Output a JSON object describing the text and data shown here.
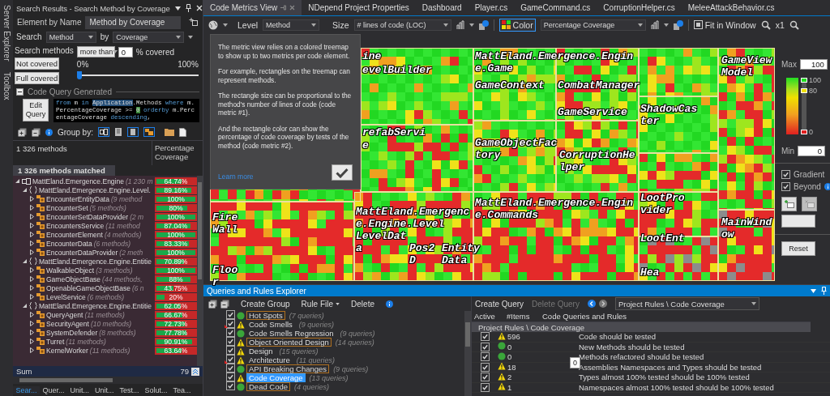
{
  "side_strip": {
    "tabs": [
      "Server Explorer",
      "Toolbox"
    ]
  },
  "search_panel": {
    "title": "Search Results - Search Method by Coverage",
    "tabs": [
      {
        "label": "Element by Name",
        "selected": false
      },
      {
        "label": "Method by Coverage",
        "selected": true
      }
    ],
    "search_label": "Search",
    "search_value": "Method",
    "by_label": "by",
    "by_value": "Coverage",
    "methods_label": "Search methods",
    "buttons": [
      "Not covered",
      "Full covered"
    ],
    "comparison": "more than",
    "threshold": "0",
    "threshold_suffix": "% covered",
    "range_min": "0%",
    "range_max": "100%",
    "slider": {
      "level": 0
    },
    "query_section": {
      "title": "Code Query Generated",
      "expanded": true
    },
    "edit_button": "Edit Query",
    "query_tokens": [
      {
        "text": "from",
        "kind": "keyword"
      },
      {
        "text": " m ",
        "kind": "plain"
      },
      {
        "text": "in ",
        "kind": "keyword"
      },
      {
        "text": "Application",
        "kind": "highlight"
      },
      {
        "text": ".Methods ",
        "kind": "plain"
      },
      {
        "text": "where",
        "kind": "keyword"
      },
      {
        "text": " m.PercentageCoverage >= ",
        "kind": "plain"
      },
      {
        "text": "0",
        "kind": "number"
      },
      {
        "text": " orderby",
        "kind": "keyword"
      },
      {
        "text": " m.PercentageCoverage ",
        "kind": "plain"
      },
      {
        "text": "descending",
        "kind": "keyword"
      },
      {
        "text": ",",
        "kind": "plain"
      }
    ],
    "group_by_label": "Group by:",
    "count_header": "1 326 methods",
    "coverage_header": "Percentage Coverage",
    "matched_label": "1 326 methods matched",
    "tree": [
      {
        "kind": "assembly",
        "name": "MattEland.Emergence.Engine",
        "count": "(1 230 m",
        "level": 0.6474,
        "value": "64.74%",
        "expanded": true,
        "children": [
          {
            "kind": "namespace",
            "name": "MattEland.Emergence.Engine.Level.",
            "level": 0.8916,
            "value": "89.16%",
            "expanded": true,
            "children": [
              {
                "kind": "class",
                "name": "EncounterEntityData",
                "count": "(9 method",
                "level": 1,
                "value": "100%",
                "expanded": false
              },
              {
                "kind": "class",
                "name": "EncounterSet",
                "count": "(5 methods)",
                "level": 0.8,
                "value": "80%",
                "expanded": false
              },
              {
                "kind": "class",
                "name": "EncounterSetDataProvider",
                "count": "(2 m",
                "level": 1,
                "value": "100%",
                "expanded": false
              },
              {
                "kind": "class",
                "name": "EncountersService",
                "count": "(11 method",
                "level": 0.8704,
                "value": "87.04%",
                "expanded": false
              },
              {
                "kind": "class",
                "name": "EncounterElement",
                "count": "(4 methods)",
                "level": 1,
                "value": "100%",
                "expanded": false
              },
              {
                "kind": "class",
                "name": "EncounterData",
                "count": "(6 methods)",
                "level": 0.8333,
                "value": "83.33%",
                "expanded": false
              },
              {
                "kind": "class",
                "name": "EncounterDataProvider",
                "count": "(2 meth",
                "level": 1,
                "value": "100%",
                "expanded": false
              }
            ]
          },
          {
            "kind": "namespace",
            "name": "MattEland.Emergence.Engine.Entitie",
            "level": 0.7089,
            "value": "70.89%",
            "expanded": true,
            "children": [
              {
                "kind": "class",
                "name": "WalkableObject",
                "count": "(3 methods)",
                "level": 1,
                "value": "100%",
                "expanded": false
              },
              {
                "kind": "class",
                "name": "GameObjectBase",
                "count": "(44 methods,",
                "level": 0.88,
                "value": "88%",
                "expanded": false
              },
              {
                "kind": "class",
                "name": "OpenableGameObjectBase",
                "count": "(6 n",
                "level": 0.4375,
                "value": "43.75%",
                "expanded": false
              },
              {
                "kind": "class",
                "name": "LevelService",
                "count": "(6 methods)",
                "level": 0.2,
                "value": "20%",
                "expanded": false
              }
            ]
          },
          {
            "kind": "namespace",
            "name": "MattEland.Emergence.Engine.Entitie",
            "level": 0.6205,
            "value": "62.05%",
            "expanded": true,
            "children": [
              {
                "kind": "class",
                "name": "QueryAgent",
                "count": "(11 methods)",
                "level": 0.6667,
                "value": "66.67%",
                "expanded": false
              },
              {
                "kind": "class",
                "name": "SecurityAgent",
                "count": "(10 methods)",
                "level": 0.7273,
                "value": "72.73%",
                "expanded": false
              },
              {
                "kind": "class",
                "name": "SystemDefender",
                "count": "(8 methods)",
                "level": 0.7778,
                "value": "77.78%",
                "expanded": false
              },
              {
                "kind": "class",
                "name": "Turret",
                "count": "(11 methods)",
                "level": 0.9091,
                "value": "90.91%",
                "expanded": false
              },
              {
                "kind": "class",
                "name": "KernelWorker",
                "count": "(11 methods)",
                "level": 0.6364,
                "value": "63.64%",
                "expanded": false
              }
            ]
          }
        ]
      }
    ],
    "sum_label": "Sum",
    "sum_value": "79",
    "bottom_tabs": [
      {
        "label": "Sear...",
        "selected": true
      },
      {
        "label": "Quer...",
        "selected": false
      },
      {
        "label": "Unit...",
        "selected": false
      },
      {
        "label": "Unit...",
        "selected": false
      },
      {
        "label": "Test...",
        "selected": false
      },
      {
        "label": "Solut...",
        "selected": false
      },
      {
        "label": "Tea...",
        "selected": false
      }
    ]
  },
  "editor_tabs": [
    {
      "label": "Code Metrics View",
      "selected": true
    },
    {
      "label": "NDepend Project Properties",
      "selected": false
    },
    {
      "label": "Dashboard",
      "selected": false
    },
    {
      "label": "Player.cs",
      "selected": false
    },
    {
      "label": "GameCommand.cs",
      "selected": false
    },
    {
      "label": "CorruptionHelper.cs",
      "selected": false
    },
    {
      "label": "MeleeAttackBehavior.cs",
      "selected": false
    }
  ],
  "toolbar": {
    "level_label": "Level",
    "level_value": "Method",
    "size_label": "Size",
    "size_value": "# lines of code (LOC)",
    "color_label": "Color",
    "color_value": "Percentage Coverage",
    "fit_label": "Fit in Window",
    "zoom": "x1"
  },
  "tooltip": {
    "paragraphs": [
      "The metric view relies on a colored treemap to show up to two metrics per code element.",
      "For example, rectangles on the treemap can represent methods.",
      "The rectangle size can be proportional to the method's number of lines of code (code metric #1).",
      "And the rectangle color can show the percentage of code coverage by tests of the method (code metric #2)."
    ],
    "link": "Learn more"
  },
  "treemap": {
    "labels": [
      "ine",
      "evelBuilder",
      "refabServi",
      "e",
      "MattEland.Emergence.Engine.Game",
      "GameContext",
      "CombatManager",
      "GameService",
      "ShadowCaster",
      "GameObjectFactory",
      "CorruptionHelper",
      "GameViewModel",
      "Fire Wall",
      "MattEland.Emergence.Engine.Level",
      "MattEland.Emergence.Engine.Commands",
      "LootProvider",
      "LevelData",
      "Pos2D",
      "EntityData",
      "LootEnt",
      "MainWindow",
      "Floor",
      "Hea"
    ]
  },
  "legend": {
    "max_label": "Max",
    "max_value": "100",
    "thumbs": [
      {
        "label": "100",
        "level": 1,
        "color": "#22dd22"
      },
      {
        "label": "80",
        "level": 0.8,
        "color": "#f0e000"
      },
      {
        "label": "0",
        "level": 0,
        "color": "#e02020"
      }
    ],
    "min_label": "Min",
    "min_value": "0",
    "options": [
      {
        "label": "Gradient",
        "checked": true
      },
      {
        "label": "Beyond",
        "checked": true
      }
    ],
    "reset": "Reset"
  },
  "queries_panel": {
    "title": "Queries and Rules Explorer",
    "create_group": "Create Group",
    "rule_file": "Rule File",
    "delete": "Delete",
    "groups": [
      {
        "name": "Hot Spots",
        "count": "(7 queries)",
        "kind": "ok",
        "checked": true,
        "outlined": true,
        "flagged": false,
        "selected": false
      },
      {
        "name": "Code Smells",
        "count": "(9 queries)",
        "kind": "warning",
        "checked": true,
        "outlined": false,
        "flagged": true,
        "selected": false
      },
      {
        "name": "Code Smells Regression",
        "count": "(9 queries)",
        "kind": "ok",
        "checked": true,
        "outlined": false,
        "flagged": false,
        "selected": false
      },
      {
        "name": "Object Oriented Design",
        "count": "(14 queries)",
        "kind": "warning",
        "checked": true,
        "outlined": true,
        "flagged": false,
        "selected": false
      },
      {
        "name": "Design",
        "count": "(15 queries)",
        "kind": "warning",
        "checked": true,
        "outlined": false,
        "flagged": false,
        "selected": false
      },
      {
        "name": "Architecture",
        "count": "(11 queries)",
        "kind": "warning",
        "checked": true,
        "outlined": false,
        "flagged": true,
        "selected": false
      },
      {
        "name": "API Breaking Changes",
        "count": "(9 queries)",
        "kind": "ok",
        "checked": true,
        "outlined": true,
        "flagged": false,
        "selected": false
      },
      {
        "name": "Code Coverage",
        "count": "(13 queries)",
        "kind": "warning",
        "checked": true,
        "outlined": false,
        "flagged": false,
        "selected": true
      },
      {
        "name": "Dead Code",
        "count": "(4 queries)",
        "kind": "ok",
        "checked": true,
        "outlined": true,
        "flagged": false,
        "selected": false
      }
    ]
  },
  "rules_panel": {
    "toolbar": [
      {
        "label": "Create Query",
        "disabled": false
      },
      {
        "label": "Delete Query",
        "disabled": true
      }
    ],
    "path": "Project Rules \\ Code Coverage",
    "columns": [
      "Active",
      "#Items",
      "Code Queries and Rules"
    ],
    "group_row": "Project Rules \\ Code Coverage",
    "rows": [
      {
        "active": true,
        "kind": "warning",
        "items": "596",
        "name": "Code should be tested"
      },
      {
        "active": true,
        "kind": "ok",
        "items": "0",
        "name": "New Methods should be tested"
      },
      {
        "active": true,
        "kind": "ok",
        "items": "0",
        "name": "Methods refactored should be tested"
      },
      {
        "active": true,
        "kind": "warning",
        "items": "18",
        "name": "Assemblies Namespaces and Types should be tested"
      },
      {
        "active": true,
        "kind": "warning",
        "items": "2",
        "name": "Types almost 100% tested should be 100% tested"
      },
      {
        "active": true,
        "kind": "warning",
        "items": "1",
        "name": "Namespaces almost 100% tested should be 100% tested"
      }
    ],
    "floating_value": "0"
  }
}
